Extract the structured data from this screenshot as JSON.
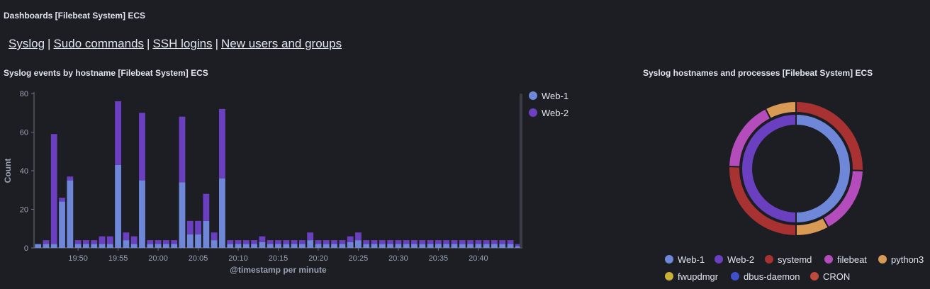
{
  "dashboard": {
    "title": "Dashboards [Filebeat System] ECS"
  },
  "nav": {
    "links": [
      "Syslog",
      "Sudo commands",
      "SSH logins",
      "New users and groups"
    ],
    "separator": "|"
  },
  "panels": {
    "bar_title": "Syslog events by hostname [Filebeat System] ECS",
    "donut_title": "Syslog hostnames and processes [Filebeat System] ECS"
  },
  "colors": {
    "web1": "#6f87d8",
    "web2": "#6a3fc0",
    "systemd": "#a83232",
    "filebeat": "#b44dbb",
    "python3": "#d99a55",
    "fwupdmgr": "#c9b13a",
    "dbus_daemon": "#3f51c9",
    "cron": "#c04a3c"
  },
  "chart_data": [
    {
      "type": "bar",
      "stacked": true,
      "xlabel": "@timestamp per minute",
      "ylabel": "Count",
      "ylim": [
        0,
        80
      ],
      "yticks": [
        0,
        20,
        40,
        60,
        80
      ],
      "xtick_labels": [
        "19:50",
        "19:55",
        "20:00",
        "20:05",
        "20:10",
        "20:15",
        "20:20",
        "20:25",
        "20:30",
        "20:35",
        "20:40"
      ],
      "xtick_bar_index": [
        5,
        10,
        15,
        20,
        25,
        30,
        35,
        40,
        45,
        50,
        55
      ],
      "legend_position": "right",
      "series": [
        {
          "name": "Web-1",
          "color": "#6f87d8",
          "values": [
            2,
            2,
            2,
            24,
            35,
            2,
            2,
            2,
            2,
            2,
            43,
            4,
            2,
            35,
            2,
            2,
            2,
            2,
            34,
            7,
            7,
            14,
            4,
            36,
            2,
            2,
            2,
            2,
            3,
            2,
            2,
            2,
            2,
            2,
            4,
            2,
            2,
            2,
            2,
            3,
            4,
            2,
            2,
            2,
            2,
            2,
            2,
            2,
            2,
            2,
            2,
            2,
            2,
            2,
            2,
            2,
            2,
            2,
            2,
            2,
            1
          ]
        },
        {
          "name": "Web-2",
          "color": "#6a3fc0",
          "values": [
            0,
            2,
            57,
            2,
            2,
            2,
            2,
            2,
            4,
            4,
            33,
            4,
            4,
            35,
            2,
            2,
            2,
            2,
            34,
            7,
            7,
            14,
            4,
            36,
            2,
            2,
            2,
            2,
            3,
            2,
            2,
            2,
            2,
            2,
            4,
            2,
            2,
            2,
            2,
            3,
            4,
            2,
            2,
            2,
            2,
            2,
            2,
            2,
            2,
            2,
            2,
            2,
            2,
            2,
            2,
            2,
            2,
            2,
            2,
            2,
            1
          ]
        }
      ]
    },
    {
      "type": "pie",
      "donut": true,
      "inner_ring": {
        "labels": [
          "Web-1",
          "Web-2"
        ],
        "values": [
          50,
          50
        ],
        "colors": [
          "#6f87d8",
          "#6a3fc0"
        ]
      },
      "outer_ring": {
        "labels": [
          "systemd",
          "filebeat",
          "python3",
          "systemd",
          "filebeat",
          "python3"
        ],
        "values": [
          25.5,
          16.5,
          8,
          25.5,
          17,
          7.5
        ],
        "colors": [
          "#a83232",
          "#b44dbb",
          "#d99a55",
          "#a83232",
          "#b44dbb",
          "#d99a55"
        ]
      },
      "legend": [
        {
          "label": "Web-1",
          "color": "#6f87d8"
        },
        {
          "label": "Web-2",
          "color": "#6a3fc0"
        },
        {
          "label": "systemd",
          "color": "#a83232"
        },
        {
          "label": "filebeat",
          "color": "#b44dbb"
        },
        {
          "label": "python3",
          "color": "#d99a55"
        },
        {
          "label": "fwupdmgr",
          "color": "#c9b13a"
        },
        {
          "label": "dbus-daemon",
          "color": "#3f51c9"
        },
        {
          "label": "CRON",
          "color": "#c04a3c"
        }
      ]
    }
  ]
}
